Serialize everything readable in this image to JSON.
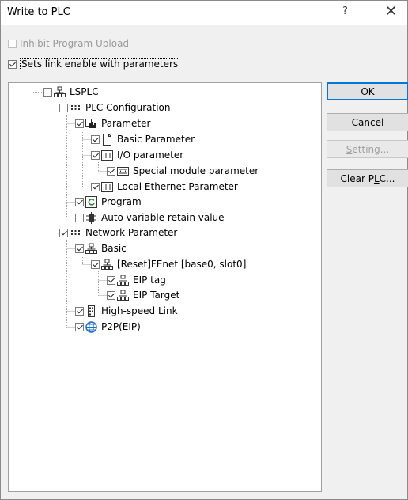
{
  "window": {
    "title": "Write to PLC",
    "help_glyph": "?",
    "close_glyph": "✕"
  },
  "options": {
    "inhibit_upload": {
      "label": "Inhibit Program Upload",
      "checked": false,
      "enabled": false
    },
    "link_enable": {
      "label": "Sets link enable with parameters",
      "checked": true,
      "enabled": true
    }
  },
  "tree": {
    "root": {
      "label": "LSPLC",
      "icon": "network-icon",
      "checked": false
    },
    "plc_configuration": {
      "label": "PLC Configuration",
      "icon": "module-grid-icon",
      "checked": false
    },
    "parameter": {
      "label": "Parameter",
      "icon": "parameter-hand-icon",
      "checked": true
    },
    "basic_parameter": {
      "label": "Basic Parameter",
      "icon": "document-icon",
      "checked": true
    },
    "io_parameter": {
      "label": "I/O parameter",
      "icon": "io-module-icon",
      "checked": true
    },
    "special_module_parameter": {
      "label": "Special module parameter",
      "icon": "special-module-icon",
      "checked": true
    },
    "local_ethernet_parameter": {
      "label": "Local Ethernet Parameter",
      "icon": "io-module-icon",
      "checked": true
    },
    "program": {
      "label": "Program",
      "icon": "program-refresh-icon",
      "checked": true
    },
    "auto_variable": {
      "label": "Auto variable retain value",
      "icon": "chip-icon",
      "checked": false
    },
    "network_parameter": {
      "label": "Network Parameter",
      "icon": "module-grid-icon",
      "checked": true
    },
    "basic": {
      "label": "Basic",
      "icon": "network-icon",
      "checked": true
    },
    "fenet": {
      "label": "[Reset]FEnet [base0, slot0]",
      "icon": "network-icon",
      "checked": true
    },
    "eip_tag": {
      "label": "EIP tag",
      "icon": "network-icon",
      "checked": true
    },
    "eip_target": {
      "label": "EIP Target",
      "icon": "network-icon",
      "checked": true
    },
    "high_speed_link": {
      "label": "High-speed Link",
      "icon": "link-module-icon",
      "checked": true
    },
    "p2p": {
      "label": "P2P(EIP)",
      "icon": "globe-icon",
      "checked": true
    }
  },
  "buttons": {
    "ok": {
      "label": "OK",
      "enabled": true
    },
    "cancel": {
      "label": "Cancel",
      "enabled": true
    },
    "setting": {
      "label_prefix": "",
      "label_mnemonic": "S",
      "label_suffix": "etting...",
      "enabled": false
    },
    "clear_plc": {
      "label_prefix": "Clear P",
      "label_mnemonic": "L",
      "label_suffix": "C...",
      "enabled": true
    }
  },
  "colors": {
    "accent": "#0078d7",
    "dialog_bg": "#f0f0f0",
    "tree_line": "#a0a0a0",
    "program_icon": "#1a8a2a",
    "globe_icon": "#1a6fd0"
  }
}
